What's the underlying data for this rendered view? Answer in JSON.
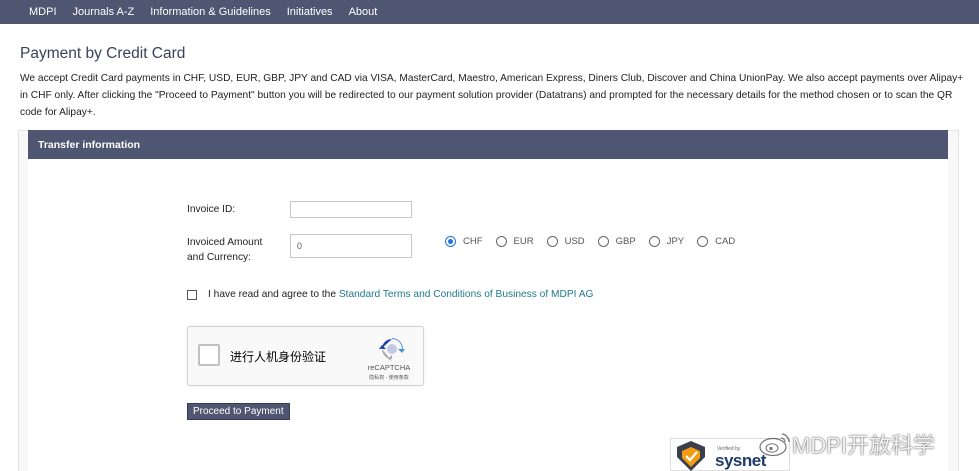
{
  "nav": {
    "items": [
      {
        "label": "MDPI"
      },
      {
        "label": "Journals A-Z"
      },
      {
        "label": "Information & Guidelines"
      },
      {
        "label": "Initiatives"
      },
      {
        "label": "About"
      }
    ]
  },
  "page": {
    "title": "Payment by Credit Card",
    "intro": "We accept Credit Card payments in CHF, USD, EUR, GBP, JPY and CAD via VISA, MasterCard, Maestro, American Express, Diners Club, Discover and China UnionPay. We also accept payments over Alipay+ in CHF only. After clicking the \"Proceed to Payment\" button you will be redirected to our payment solution provider (Datatrans) and prompted for the necessary details for the method chosen or to scan the QR code for Alipay+."
  },
  "form": {
    "header": "Transfer information",
    "invoice_id_label": "Invoice ID:",
    "invoice_id_value": "",
    "amount_label_line1": "Invoiced Amount",
    "amount_label_line2": "and Currency:",
    "amount_value": "0",
    "currencies": [
      {
        "label": "CHF",
        "checked": true
      },
      {
        "label": "EUR",
        "checked": false
      },
      {
        "label": "USD",
        "checked": false
      },
      {
        "label": "GBP",
        "checked": false
      },
      {
        "label": "JPY",
        "checked": false
      },
      {
        "label": "CAD",
        "checked": false
      }
    ],
    "terms_prefix": "I have read and agree to the ",
    "terms_link": "Standard Terms and Conditions of Business of MDPI AG",
    "terms_checked": false,
    "submit_label": "Proceed to Payment"
  },
  "recaptcha": {
    "label": "进行人机身份验证",
    "brand": "reCAPTCHA",
    "privacy": "隐私权 - 使用条款"
  },
  "badge": {
    "verified": "Verified by",
    "brand": "sysnet"
  },
  "watermark": {
    "text": "MDPI开放科学"
  },
  "colors": {
    "nav_bg": "#4f5671",
    "link": "#1f7a8c",
    "radio_checked": "#1a73e8"
  }
}
